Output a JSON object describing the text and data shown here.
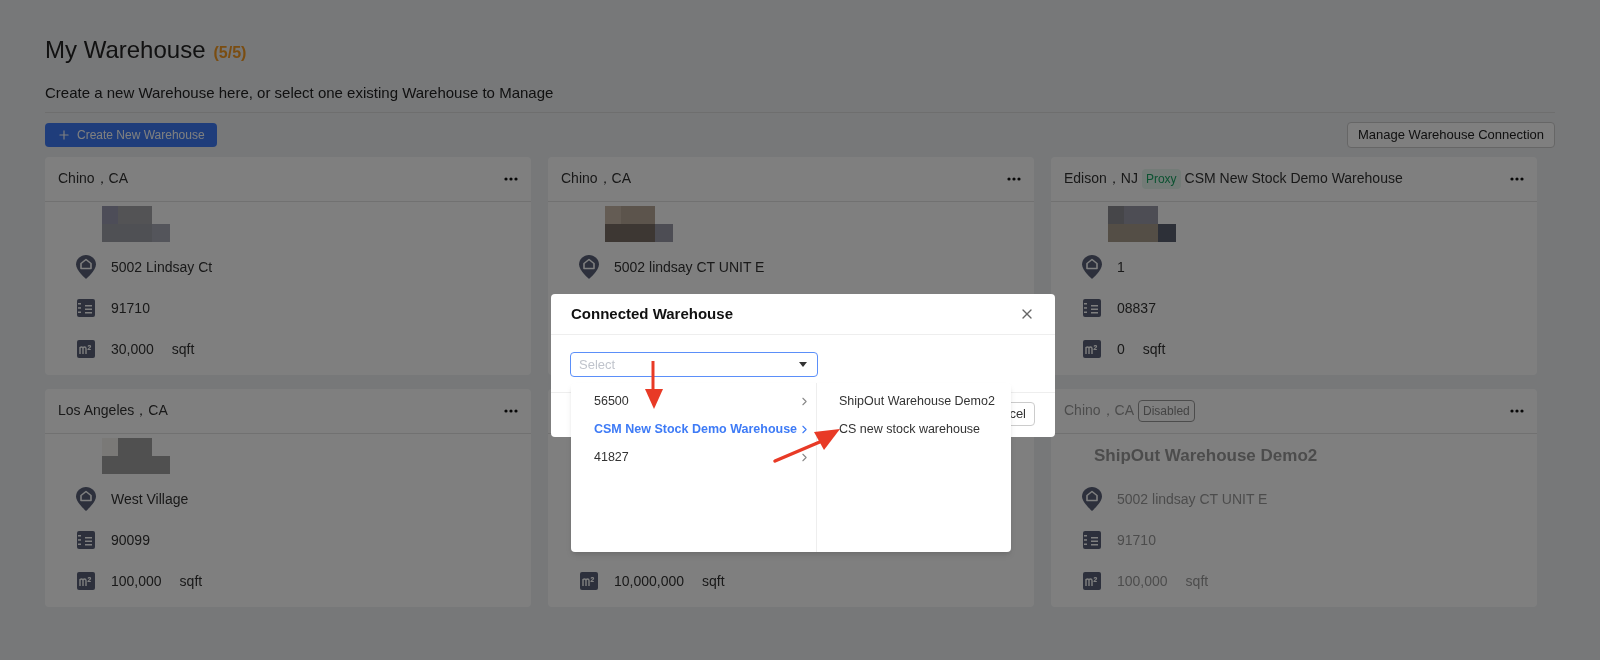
{
  "page": {
    "title": "My Warehouse",
    "count": "(5/5)",
    "subtitle": "Create a new Warehouse here, or select one existing Warehouse to Manage",
    "create_button": "Create New Warehouse",
    "manage_button": "Manage Warehouse Connection"
  },
  "cards": [
    {
      "title": "Chino，CA",
      "menu": true,
      "disabled": false,
      "image": {
        "kind": "picture"
      },
      "address": "5002 Lindsay Ct",
      "postal": "91710",
      "area": "30,000",
      "unit": "sqft"
    },
    {
      "title": "Chino，CA",
      "menu": true,
      "disabled": false,
      "image": {
        "kind": "picture"
      },
      "address": "5002 lindsay CT UNIT E"
    },
    {
      "title": "Edison，NJ",
      "tags": [
        {
          "kind": "proxy",
          "label": "Proxy"
        }
      ],
      "subtitle": "CSM New Stock Demo Warehouse",
      "menu": true,
      "disabled": false,
      "image": {
        "kind": "picture"
      },
      "address": "1",
      "postal": "08837",
      "area": "0",
      "unit": "sqft"
    },
    {
      "title": "Los Angeles，CA",
      "menu": true,
      "disabled": false,
      "image": {
        "kind": "picture"
      },
      "address": "West Village",
      "postal": "90099",
      "area": "100,000",
      "unit": "sqft"
    },
    {
      "disabled": false,
      "area": "10,000,000",
      "unit": "sqft"
    },
    {
      "title": "Chino，CA",
      "tags": [
        {
          "kind": "disabled",
          "label": "Disabled"
        }
      ],
      "menu": true,
      "disabled": true,
      "name": "ShipOut Warehouse Demo2",
      "address": "5002 lindsay CT UNIT E",
      "postal": "91710",
      "area": "100,000",
      "unit": "sqft"
    }
  ],
  "dialog": {
    "title": "Connected Warehouse",
    "select": {
      "placeholder": "Select"
    },
    "footer_button": "cel",
    "cascader": [
      {
        "items": [
          {
            "label": "56500",
            "has_children": true,
            "selected": false
          },
          {
            "label": "CSM New Stock Demo Warehouse",
            "has_children": true,
            "selected": true
          },
          {
            "label": "41827",
            "has_children": true,
            "selected": false
          }
        ]
      },
      {
        "items": [
          {
            "label": "ShipOut Warehouse Demo2",
            "has_children": false,
            "selected": false
          },
          {
            "label": "CS new stock warehouse",
            "has_children": false,
            "selected": false
          }
        ]
      }
    ]
  }
}
